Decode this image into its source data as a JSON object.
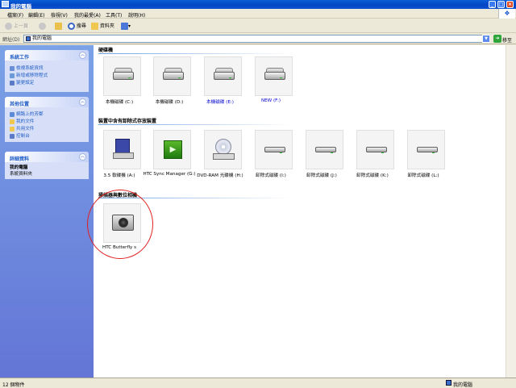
{
  "window": {
    "title": "我的電腦",
    "controls": [
      "minimize",
      "maximize",
      "close"
    ]
  },
  "menu": [
    "檔案(F)",
    "編輯(E)",
    "檢視(V)",
    "我的最愛(A)",
    "工具(T)",
    "說明(H)"
  ],
  "toolbar": {
    "back": "上一頁",
    "forward": "",
    "up": "",
    "search": "搜尋",
    "folders": "資料夾",
    "views": ""
  },
  "address": {
    "label": "網址(D)",
    "value": "我的電腦",
    "go": "移至"
  },
  "sidebar": {
    "system_tasks": {
      "title": "系統工作",
      "items": [
        "檢視系統資訊",
        "新增或移除程式",
        "變更設定"
      ]
    },
    "other_places": {
      "title": "其他位置",
      "items": [
        "網路上的芳鄰",
        "我的文件",
        "共用文件",
        "控制台"
      ]
    },
    "details": {
      "title": "詳細資料",
      "name": "我的電腦",
      "type": "系統資料夾"
    }
  },
  "sections": {
    "hard_disks": {
      "title": "硬碟機",
      "items": [
        {
          "label": "本機磁碟 (C:)",
          "icon": "hard-disk-icon",
          "color": "#000000"
        },
        {
          "label": "本機磁碟 (D:)",
          "icon": "hard-disk-icon",
          "color": "#000000"
        },
        {
          "label": "本機磁碟 (E:)",
          "icon": "hard-disk-icon",
          "color": "#0000d0"
        },
        {
          "label": "NEW (F:)",
          "icon": "hard-disk-icon",
          "color": "#0000d0"
        }
      ]
    },
    "removable": {
      "title": "裝置中含有卸除式存放裝置",
      "items": [
        {
          "label": "3.5 軟碟機 (A:)",
          "icon": "floppy-drive-icon"
        },
        {
          "label": "HTC Sync Manager (G:)",
          "icon": "htc-sync-icon"
        },
        {
          "label": "DVD-RAM 光碟機 (H:)",
          "icon": "dvd-drive-icon"
        },
        {
          "label": "卸除式磁碟 (I:)",
          "icon": "removable-disk-icon"
        },
        {
          "label": "卸除式磁碟 (J:)",
          "icon": "removable-disk-icon"
        },
        {
          "label": "卸除式磁碟 (K:)",
          "icon": "removable-disk-icon"
        },
        {
          "label": "卸除式磁碟 (L:)",
          "icon": "removable-disk-icon"
        }
      ]
    },
    "cameras": {
      "title": "掃描器與數位相機",
      "items": [
        {
          "label": "HTC Butterfly s",
          "icon": "camera-icon"
        }
      ]
    }
  },
  "status": {
    "count": "12 個物件",
    "location": "我的電腦"
  },
  "annotation": {
    "color": "#e02020",
    "shape": "circle"
  }
}
